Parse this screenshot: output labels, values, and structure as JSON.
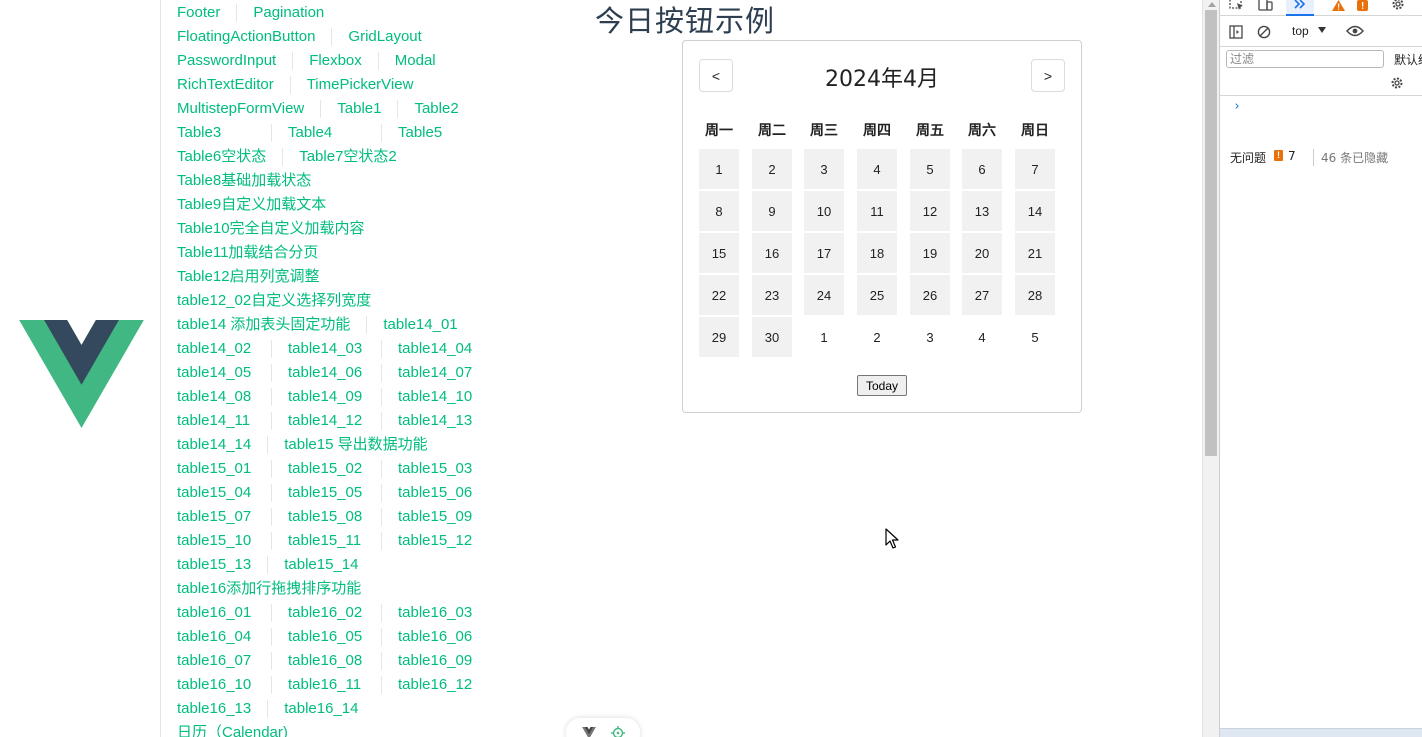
{
  "nav": {
    "rows": [
      [
        "Footer",
        "Pagination"
      ],
      [
        "FloatingActionButton",
        "GridLayout"
      ],
      [
        "PasswordInput",
        "Flexbox",
        "Modal"
      ],
      [
        "RichTextEditor",
        "TimePickerView"
      ],
      [
        "MultistepFormView",
        "Table1",
        "Table2"
      ],
      [
        "Table3",
        "Table4",
        "Table5"
      ],
      [
        "Table6空状态",
        "Table7空状态2"
      ],
      [
        "Table8基础加载状态"
      ],
      [
        "Table9自定义加载文本"
      ],
      [
        "Table10完全自定义加载内容"
      ],
      [
        "Table11加载结合分页"
      ],
      [
        "Table12启用列宽调整"
      ],
      [
        "table12_02自定义选择列宽度"
      ],
      [
        "table14 添加表头固定功能",
        "table14_01"
      ],
      [
        "table14_02",
        "table14_03",
        "table14_04"
      ],
      [
        "table14_05",
        "table14_06",
        "table14_07"
      ],
      [
        "table14_08",
        "table14_09",
        "table14_10"
      ],
      [
        "table14_11",
        "table14_12",
        "table14_13"
      ],
      [
        "table14_14",
        "table15 导出数据功能"
      ],
      [
        "table15_01",
        "table15_02",
        "table15_03"
      ],
      [
        "table15_04",
        "table15_05",
        "table15_06"
      ],
      [
        "table15_07",
        "table15_08",
        "table15_09"
      ],
      [
        "table15_10",
        "table15_11",
        "table15_12"
      ],
      [
        "table15_13",
        "table15_14"
      ],
      [
        "table16添加行拖拽排序功能"
      ],
      [
        "table16_01",
        "table16_02",
        "table16_03"
      ],
      [
        "table16_04",
        "table16_05",
        "table16_06"
      ],
      [
        "table16_07",
        "table16_08",
        "table16_09"
      ],
      [
        "table16_10",
        "table16_11",
        "table16_12"
      ],
      [
        "table16_13",
        "table16_14"
      ],
      [
        "日历（Calendar)"
      ]
    ]
  },
  "page": {
    "title": "今日按钮示例"
  },
  "calendar": {
    "month_label": "2024年4月",
    "prev_label": "<",
    "next_label": ">",
    "today_label": "Today",
    "weekdays": [
      "周一",
      "周二",
      "周三",
      "周四",
      "周五",
      "周六",
      "周日"
    ],
    "days": [
      {
        "d": "1",
        "current": true
      },
      {
        "d": "2",
        "current": true
      },
      {
        "d": "3",
        "current": true
      },
      {
        "d": "4",
        "current": true
      },
      {
        "d": "5",
        "current": true
      },
      {
        "d": "6",
        "current": true
      },
      {
        "d": "7",
        "current": true
      },
      {
        "d": "8",
        "current": true
      },
      {
        "d": "9",
        "current": true
      },
      {
        "d": "10",
        "current": true
      },
      {
        "d": "11",
        "current": true
      },
      {
        "d": "12",
        "current": true
      },
      {
        "d": "13",
        "current": true
      },
      {
        "d": "14",
        "current": true
      },
      {
        "d": "15",
        "current": true
      },
      {
        "d": "16",
        "current": true
      },
      {
        "d": "17",
        "current": true
      },
      {
        "d": "18",
        "current": true
      },
      {
        "d": "19",
        "current": true
      },
      {
        "d": "20",
        "current": true
      },
      {
        "d": "21",
        "current": true
      },
      {
        "d": "22",
        "current": true
      },
      {
        "d": "23",
        "current": true
      },
      {
        "d": "24",
        "current": true
      },
      {
        "d": "25",
        "current": true
      },
      {
        "d": "26",
        "current": true
      },
      {
        "d": "27",
        "current": true
      },
      {
        "d": "28",
        "current": true
      },
      {
        "d": "29",
        "current": true
      },
      {
        "d": "30",
        "current": true
      },
      {
        "d": "1",
        "current": false
      },
      {
        "d": "2",
        "current": false
      },
      {
        "d": "3",
        "current": false
      },
      {
        "d": "4",
        "current": false
      },
      {
        "d": "5",
        "current": false
      }
    ]
  },
  "devtools": {
    "context": "top",
    "filter_placeholder": "过滤",
    "levels_label": "默认级",
    "no_issues": "无问题",
    "issues_count": "7",
    "hidden_label": "46 条已隐藏",
    "prompt": "›"
  },
  "colors": {
    "link": "#10b981",
    "vue_green": "#41b883",
    "vue_dark": "#34495e"
  }
}
